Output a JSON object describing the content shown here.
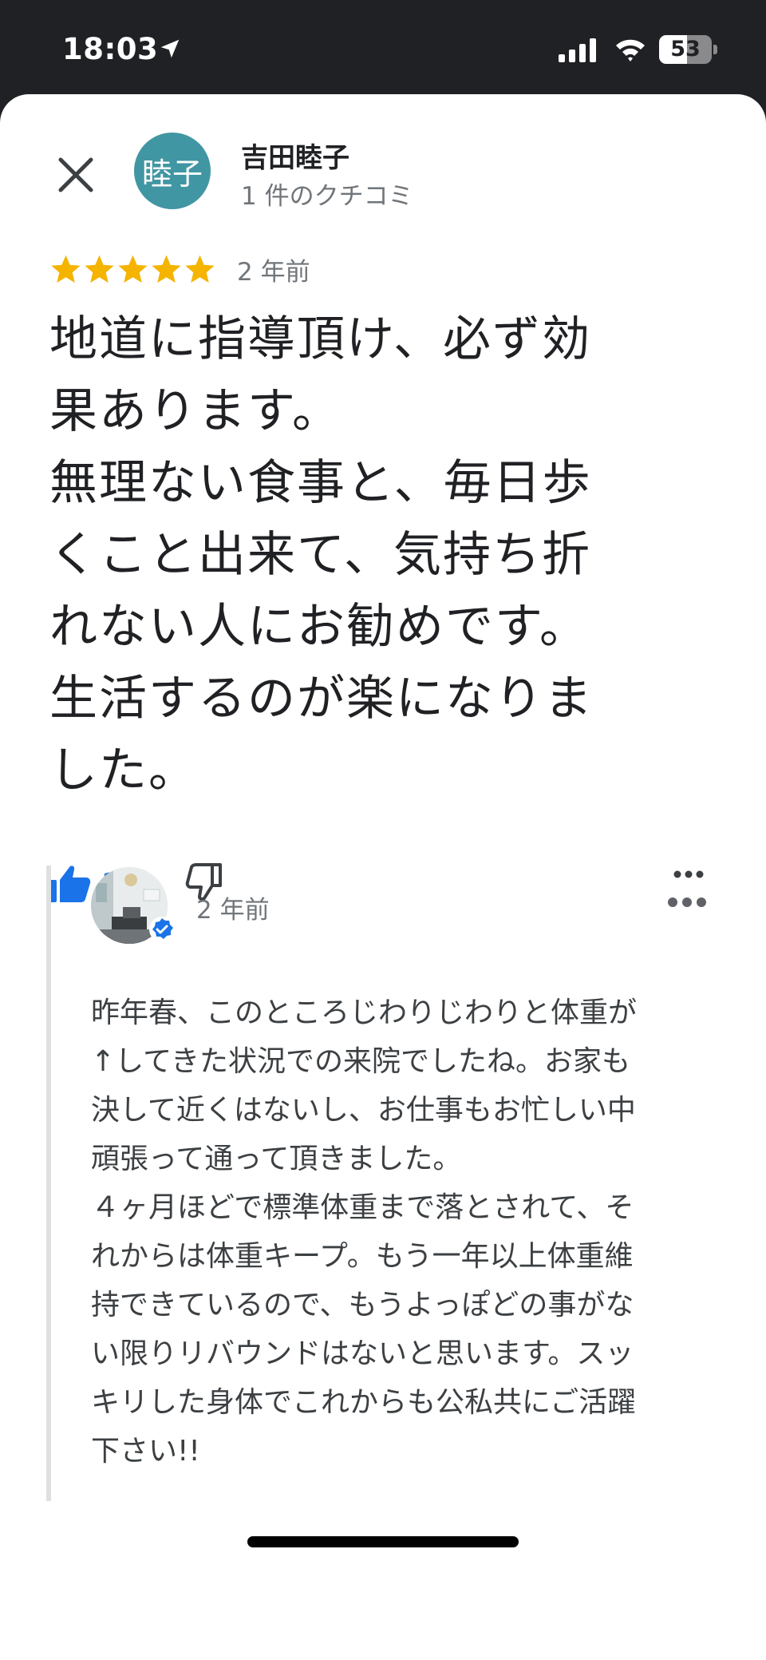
{
  "status_bar": {
    "time": "18:03",
    "battery_level": "53",
    "battery_fraction": 0.53
  },
  "reviewer": {
    "avatar_text": "睦子",
    "name": "吉田睦子",
    "meta": "1 件のクチコミ"
  },
  "review": {
    "rating": 5,
    "date": "2 年前",
    "text": "地道に指導頂け、必ず効\n果あります。\n無理ない食事と、毎日歩\nくこと出来て、気持ち折\nれない人にお勧めです。\n生活するのが楽になりま\nした。",
    "like_count": "2"
  },
  "response": {
    "date": "2 年前",
    "text": "昨年春、このところじわりじわりと体重が\n↑してきた状況での来院でしたね。お家も\n決して近くはないし、お仕事もお忙しい中\n頑張って通って頂きました。\n４ヶ月ほどで標準体重まで落とされて、そ\nれからは体重キープ。もう一年以上体重維\n持できているので、もうよっぽどの事がな\nい限りリバウンドはないと思います。スッ\nキリした身体でこれからも公私共にご活躍\n下さい!!"
  },
  "colors": {
    "star": "#f4b400",
    "accent": "#1a73e8",
    "avatar_bg": "#4196a3",
    "secondary_text": "#70757a"
  },
  "icons": [
    "location-arrow-icon",
    "signal-icon",
    "wifi-icon",
    "battery-icon",
    "close-icon",
    "star-icon",
    "thumbs-up-icon",
    "thumbs-down-icon",
    "more-icon",
    "verified-icon"
  ]
}
